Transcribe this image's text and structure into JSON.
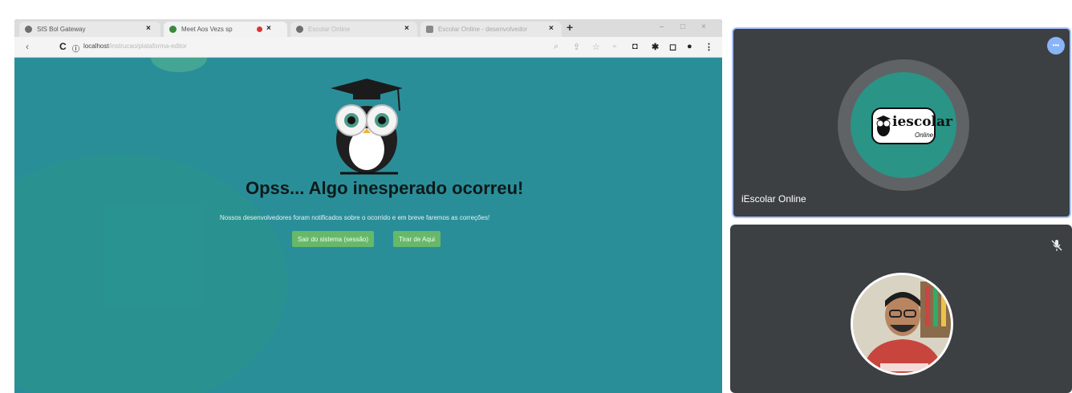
{
  "browser": {
    "tabs": [
      {
        "label": "SIS Bol Gateway"
      },
      {
        "label": "Meet Aos Vezs sp"
      },
      {
        "label": "Escolar Online"
      },
      {
        "label": "Escolar Online - desenvolvedor"
      }
    ],
    "url_host": "localhost",
    "url_rest": "/instrucao/plataforma-editor"
  },
  "error_page": {
    "title": "Opss... Algo inesperado ocorreu!",
    "subtitle": "Nossos desenvolvedores foram notificados sobre o ocorrido e em breve faremos as correções!",
    "buttons": [
      "Sair do sistema (sessão)",
      "Tirar de Aqui"
    ]
  },
  "meet": {
    "tile1": {
      "name": "iEscolar Online",
      "logo_text": "iescolar",
      "logo_sub": "Online",
      "menu_label": "•••"
    },
    "tile2": {
      "mic": "muted"
    }
  },
  "colors": {
    "page_bg": "#2a8e99",
    "button": "#68b86a",
    "tile_bg": "#3c4043",
    "active_border": "#a9c4ff",
    "avatar_ring": "#2a9486"
  },
  "icons": [
    "chrome-icon",
    "meet-icon",
    "close-icon",
    "new-tab-icon",
    "back-icon",
    "reload-icon",
    "zoom-icon",
    "star-icon",
    "extension-icon",
    "menu-icon",
    "owl-mascot-icon",
    "mic-off-icon"
  ]
}
